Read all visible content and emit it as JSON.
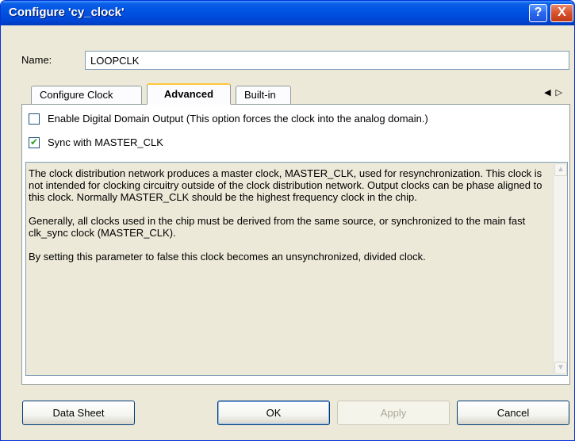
{
  "window": {
    "title": "Configure 'cy_clock'",
    "help_glyph": "?",
    "close_glyph": "X"
  },
  "name": {
    "label": "Name:",
    "value": "LOOPCLK"
  },
  "tabs": [
    {
      "label": "Configure Clock",
      "active": false
    },
    {
      "label": "Advanced",
      "active": true
    },
    {
      "label": "Built-in",
      "active": false
    }
  ],
  "tab_scroll_glyphs": "◀▷",
  "options": {
    "enable_digital": {
      "label": "Enable Digital Domain Output (This option forces the clock into the analog domain.)",
      "checked": false
    },
    "sync_master": {
      "label": "Sync with MASTER_CLK",
      "checked": true
    }
  },
  "description": [
    "The clock distribution network produces a master clock, MASTER_CLK, used for resynchronization. This clock is not intended for clocking circuitry outside of the clock distribution network. Output clocks can be phase aligned to this clock. Normally MASTER_CLK should be the highest frequency clock in the chip.",
    "Generally, all clocks used in the chip must be derived from the same source, or synchronized to the main fast clk_sync clock (MASTER_CLK).",
    "By setting this parameter to false this clock becomes an unsynchronized, divided clock."
  ],
  "buttons": {
    "datasheet": "Data Sheet",
    "ok": "OK",
    "apply": "Apply",
    "cancel": "Cancel"
  },
  "colors": {
    "titlebar": "#0054e3",
    "dialog_bg": "#ece9d8",
    "active_tab_accent": "#ffc73c"
  },
  "icons": {
    "help": "help-icon",
    "close": "close-icon",
    "checkmark": "checkmark-icon"
  }
}
